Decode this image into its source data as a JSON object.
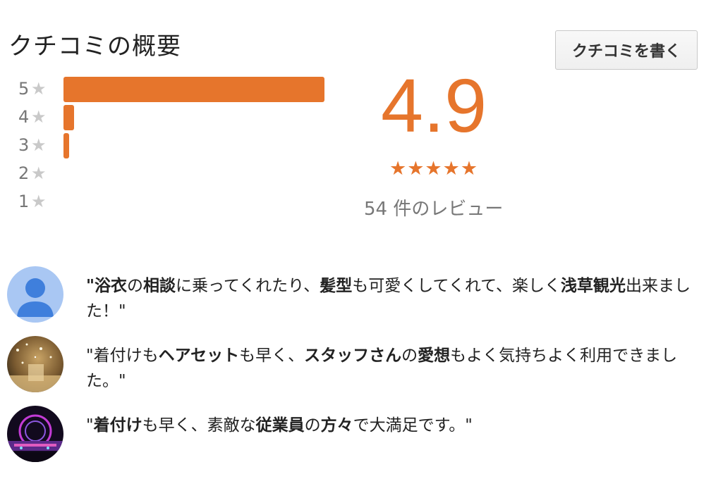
{
  "header": {
    "title": "クチコミの概要",
    "write_button_label": "クチコミを書く"
  },
  "rating": {
    "score": "4.9",
    "stars": "★★★★★",
    "review_count_text": "54 件のレビュー",
    "accent_color": "#e6752c",
    "histogram": [
      {
        "label": "5",
        "star": "★",
        "fraction": 1.0
      },
      {
        "label": "4",
        "star": "★",
        "fraction": 0.04
      },
      {
        "label": "3",
        "star": "★",
        "fraction": 0.02
      },
      {
        "label": "2",
        "star": "★",
        "fraction": 0.0
      },
      {
        "label": "1",
        "star": "★",
        "fraction": 0.0
      }
    ]
  },
  "reviews": [
    {
      "avatar": "default-user-avatar",
      "segments": [
        {
          "t": "\"",
          "b": true
        },
        {
          "t": "浴衣",
          "b": true
        },
        {
          "t": "の",
          "b": false
        },
        {
          "t": "相談",
          "b": true
        },
        {
          "t": "に乗ってくれたり、",
          "b": false
        },
        {
          "t": "髪型",
          "b": true
        },
        {
          "t": "も可愛くしてくれて、楽しく",
          "b": false
        },
        {
          "t": "浅草観光",
          "b": true
        },
        {
          "t": "出来ました！\"",
          "b": false
        }
      ]
    },
    {
      "avatar": "photo-avatar-gold",
      "segments": [
        {
          "t": "\"着付けも",
          "b": false
        },
        {
          "t": "ヘアセット",
          "b": true
        },
        {
          "t": "も早く、",
          "b": false
        },
        {
          "t": "スタッフさん",
          "b": true
        },
        {
          "t": "の",
          "b": false
        },
        {
          "t": "愛想",
          "b": true
        },
        {
          "t": "もよく気持ちよく利用できました。\"",
          "b": false
        }
      ]
    },
    {
      "avatar": "photo-avatar-night",
      "segments": [
        {
          "t": "\"",
          "b": false
        },
        {
          "t": "着付け",
          "b": true
        },
        {
          "t": "も早く、素敵な",
          "b": false
        },
        {
          "t": "従業員",
          "b": true
        },
        {
          "t": "の",
          "b": false
        },
        {
          "t": "方々",
          "b": true
        },
        {
          "t": "で大満足です。\"",
          "b": false
        }
      ]
    }
  ]
}
